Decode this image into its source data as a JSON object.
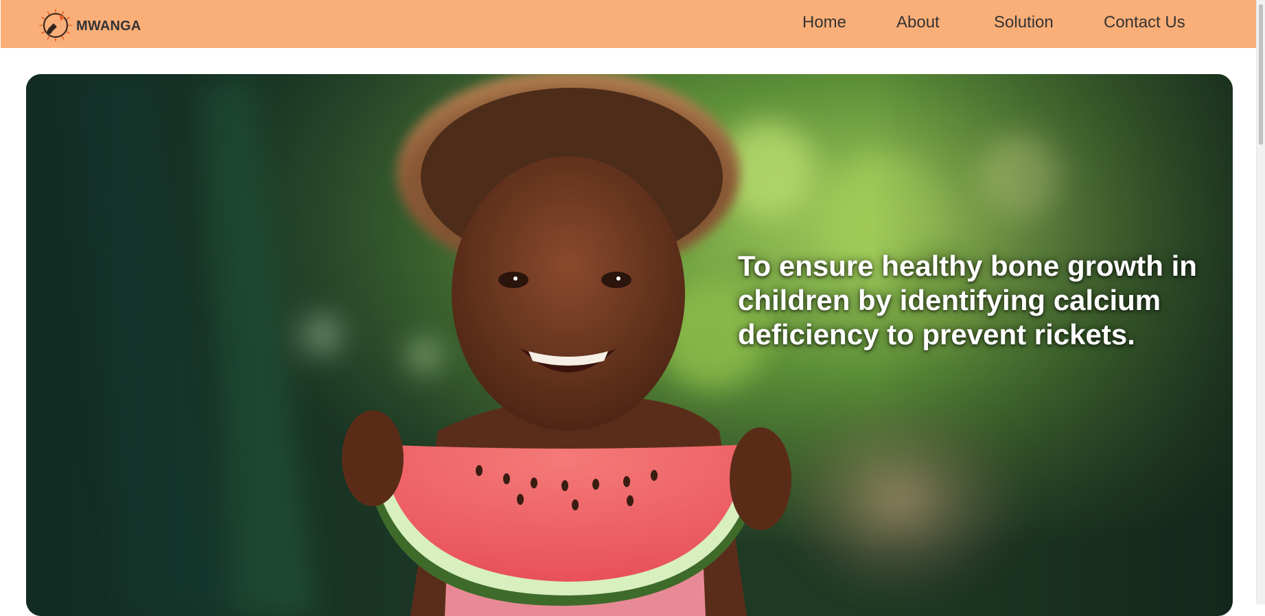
{
  "brand": {
    "name": "MWANGA",
    "logo_icon": "sun-bell-logo-icon",
    "logo_accent": "#e9602a"
  },
  "nav": {
    "links": [
      {
        "label": "Home"
      },
      {
        "label": "About"
      },
      {
        "label": "Solution"
      },
      {
        "label": "Contact Us"
      }
    ],
    "background": "#fbaf78"
  },
  "hero": {
    "tagline": "To ensure healthy bone growth in children by identifying calcium deficiency to prevent rickets.",
    "image_icon": "child-with-watermelon-photo"
  }
}
